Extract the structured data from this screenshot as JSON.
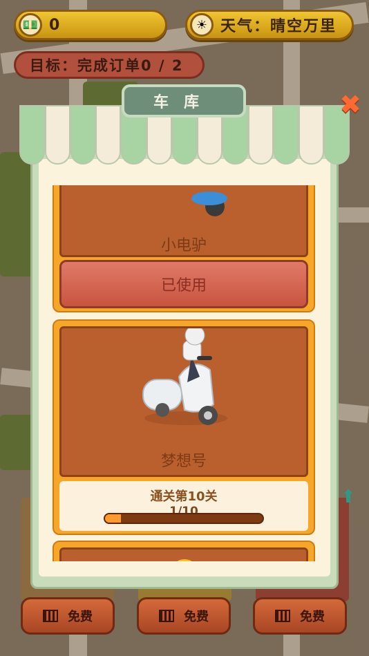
{
  "hud": {
    "money_icon": "cash-icon",
    "money": "0",
    "weather_icon": "sun-icon",
    "weather": "天气：晴空万里",
    "goal": "目标：完成订单0 / 2"
  },
  "garage": {
    "title": "车库",
    "close_icon": "close-icon",
    "vehicles": [
      {
        "name": "小电驴",
        "status": "已使用",
        "image": "electric-scooter"
      },
      {
        "name": "梦想号",
        "requirement": "通关第10关",
        "progress_text": "1/10",
        "progress": 0.1,
        "image": "sidecar-scooter-with-rider"
      },
      {
        "name": "",
        "image": "locked-vehicle"
      }
    ]
  },
  "bottom": {
    "free_buttons": [
      "免费",
      "免费",
      "免费"
    ],
    "film_icon": "video-icon"
  },
  "colors": {
    "awning_green": "#a8d3a2",
    "card_orange": "#f6a629",
    "card_brown": "#b9602e",
    "used_red": "#d05c48",
    "progress_fill": "#ff9a2e"
  }
}
